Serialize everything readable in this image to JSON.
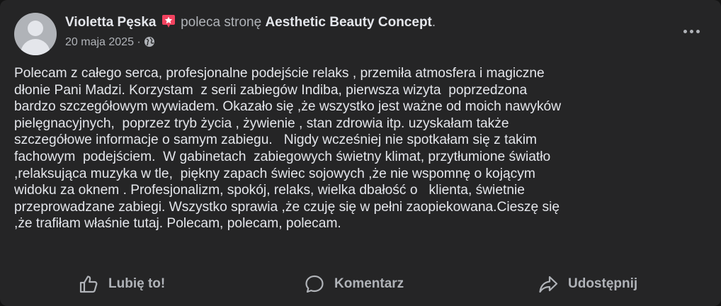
{
  "author": {
    "name": "Violetta Pęska"
  },
  "header": {
    "verb": "poleca stronę",
    "page_name": "Aesthetic Beauty Concept",
    "period": "."
  },
  "meta": {
    "date": "20 maja 2025",
    "separator": " · "
  },
  "icons": {
    "recommend": "recommend-star-icon",
    "audience": "globe-icon",
    "more": "more-options-icon",
    "like": "thumbs-up-icon",
    "comment": "comment-bubble-icon",
    "share": "share-arrow-icon"
  },
  "colors": {
    "background": "#252526",
    "text": "#e4e6eb",
    "secondary_text": "#b0b3b8",
    "recommend_badge": "#f3425f"
  },
  "post": {
    "lines": [
      "Polecam z całego serca, profesjonalne podejście relaks , przemiła atmosfera i magiczne",
      "dłonie Pani Madzi. Korzystam  z serii zabiegów Indiba, pierwsza wizyta  poprzedzona",
      "bardzo szczegółowym wywiadem. Okazało się ,że wszystko jest ważne od moich nawyków",
      "pielęgnacyjnych,  poprzez tryb życia , żywienie , stan zdrowia itp. uzyskałam także",
      "szczegółowe informacje o samym zabiegu.   Nigdy wcześniej nie spotkałam się z takim",
      "fachowym  podejściem.  W gabinetach  zabiegowych świetny klimat, przytłumione światło",
      ",relaksująca muzyka w tle,  piękny zapach świec sojowych ,że nie wspomnę o kojącym",
      "widoku za oknem . Profesjonalizm, spokój, relaks, wielka dbałość o   klienta, świetnie",
      "przeprowadzane zabiegi. Wszystko sprawia ,że czuję się w pełni zaopiekowana.Cieszę się",
      ",że trafiłam właśnie tutaj. Polecam, polecam, polecam."
    ]
  },
  "actions": {
    "like_label": "Lubię to!",
    "comment_label": "Komentarz",
    "share_label": "Udostępnij"
  }
}
